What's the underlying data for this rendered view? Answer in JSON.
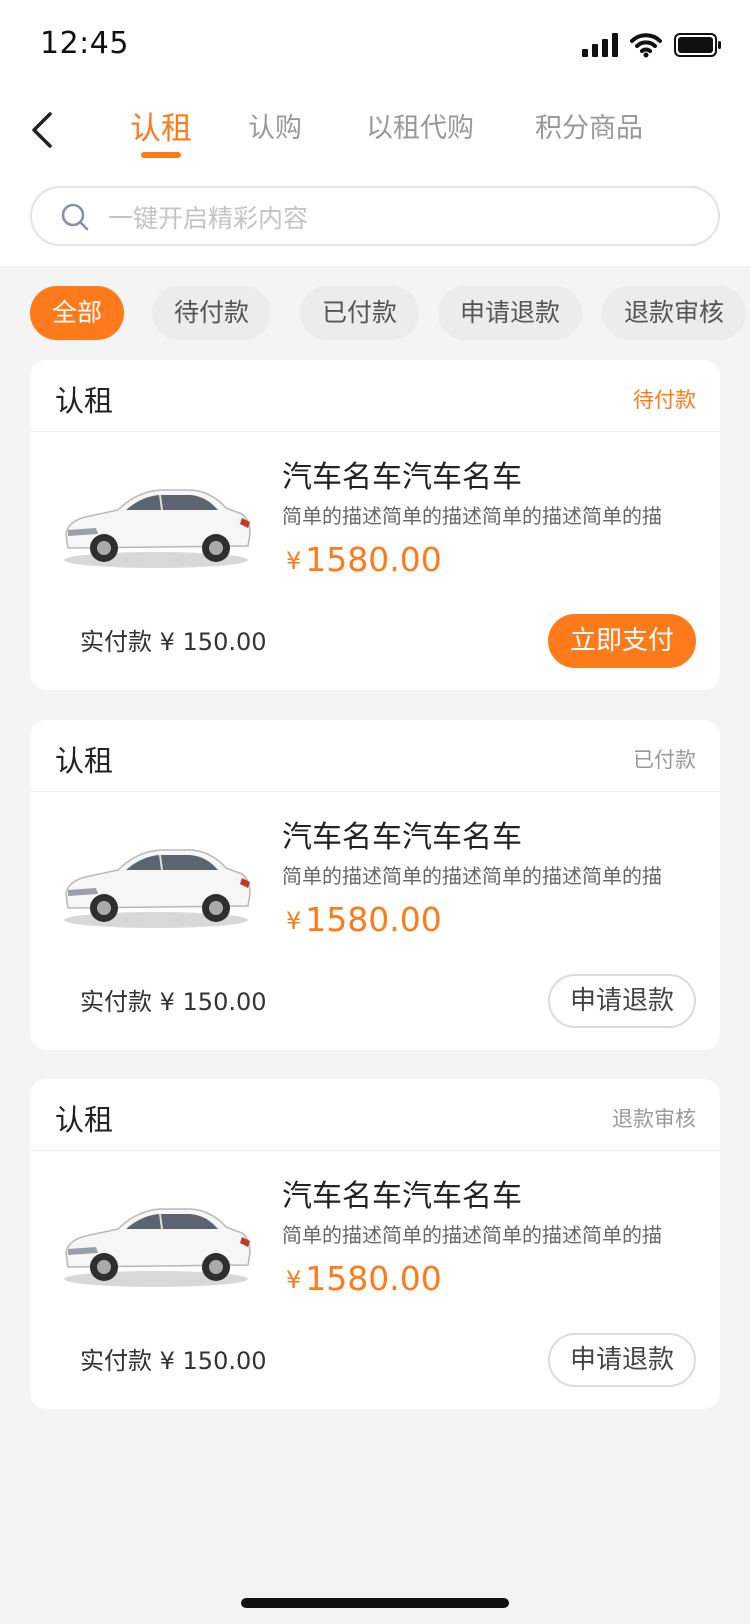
{
  "status_bar": {
    "time": "12:45"
  },
  "tabs": [
    {
      "label": "认租",
      "active": true
    },
    {
      "label": "认购",
      "active": false
    },
    {
      "label": "以租代购",
      "active": false
    },
    {
      "label": "积分商品",
      "active": false
    }
  ],
  "search": {
    "placeholder": "一键开启精彩内容",
    "value": ""
  },
  "filters": [
    {
      "label": "全部",
      "active": true
    },
    {
      "label": "待付款",
      "active": false
    },
    {
      "label": "已付款",
      "active": false
    },
    {
      "label": "申请退款",
      "active": false
    },
    {
      "label": "退款审核",
      "active": false
    }
  ],
  "orders": [
    {
      "type": "认租",
      "status": "待付款",
      "name": "汽车名车汽车名车",
      "desc": "简单的描述简单的描述简单的描述简单的描",
      "currency": "¥",
      "price": "1580.00",
      "paid": "实付款 ¥ 150.00",
      "action": "立即支付"
    },
    {
      "type": "认租",
      "status": "已付款",
      "name": "汽车名车汽车名车",
      "desc": "简单的描述简单的描述简单的描述简单的描",
      "currency": "¥",
      "price": "1580.00",
      "paid": "实付款 ¥ 150.00",
      "action": "申请退款"
    },
    {
      "type": "认租",
      "status": "退款审核",
      "name": "汽车名车汽车名车",
      "desc": "简单的描述简单的描述简单的描述简单的描",
      "currency": "¥",
      "price": "1580.00",
      "paid": "实付款 ¥ 150.00",
      "action": "申请退款"
    }
  ],
  "colors": {
    "accent": "#ff7a1a",
    "background": "#f4f4f4",
    "muted": "#999999"
  },
  "icons": {
    "back": "chevron-left-icon",
    "search": "search-icon",
    "signal": "cellular-signal-icon",
    "wifi": "wifi-icon",
    "battery": "battery-icon"
  }
}
